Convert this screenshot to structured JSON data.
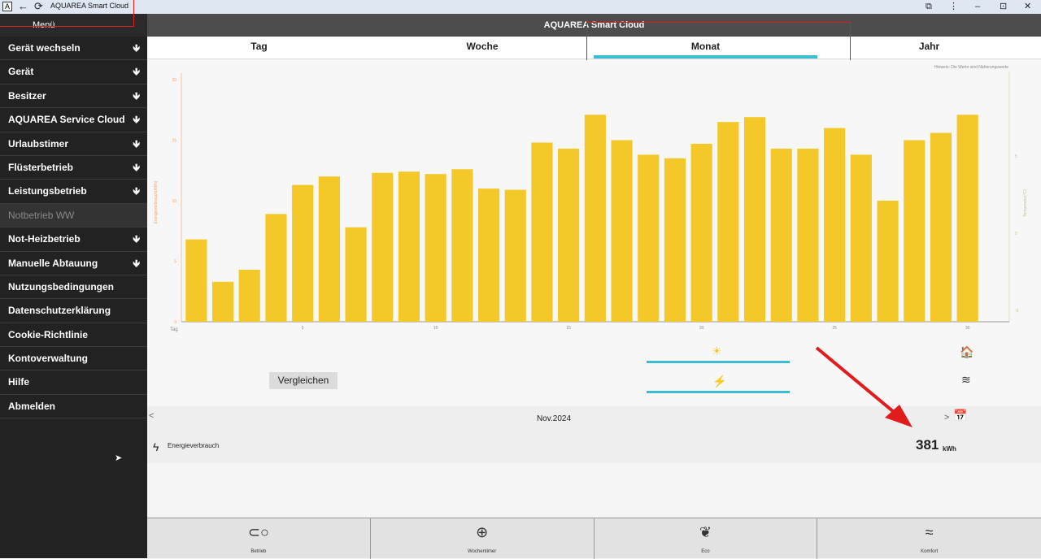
{
  "titlebar": {
    "app_icon": "A",
    "back": "←",
    "reload": "⟳",
    "title": "AQUAREA Smart Cloud",
    "extension_icon": "⧉",
    "more_icon": "⋮",
    "minimize": "–",
    "restore": "⊡",
    "close": "✕"
  },
  "sidebar": {
    "header": "Menü",
    "items": [
      {
        "label": "Gerät wechseln",
        "arrow": "🡻"
      },
      {
        "label": "Gerät",
        "arrow": "🡻"
      },
      {
        "label": "Besitzer",
        "arrow": "🡻"
      },
      {
        "label": "AQUAREA Service Cloud",
        "arrow": "🡻"
      },
      {
        "label": "Urlaubstimer",
        "arrow": "🡻"
      },
      {
        "label": "Flüsterbetrieb",
        "arrow": "🡻"
      },
      {
        "label": "Leistungsbetrieb",
        "arrow": "🡻"
      },
      {
        "label": "Notbetrieb WW",
        "arrow": ""
      },
      {
        "label": "Not-Heizbetrieb",
        "arrow": "🡻"
      },
      {
        "label": "Manuelle Abtauung",
        "arrow": "🡻"
      },
      {
        "label": "Nutzungsbedingungen",
        "arrow": ""
      },
      {
        "label": "Datenschutzerklärung",
        "arrow": ""
      },
      {
        "label": "Cookie-Richtlinie",
        "arrow": ""
      },
      {
        "label": "Kontoverwaltung",
        "arrow": ""
      },
      {
        "label": "Hilfe",
        "arrow": ""
      },
      {
        "label": "Abmelden",
        "arrow": ""
      }
    ]
  },
  "header": {
    "title": "AQUAREA Smart Cloud"
  },
  "tabs": [
    {
      "label": "Tag"
    },
    {
      "label": "Woche"
    },
    {
      "label": "Monat"
    },
    {
      "label": "Jahr"
    }
  ],
  "active_tab": "Monat",
  "hint": "Hinweis: Die Werte sind Näherungswerte",
  "chart_data": {
    "type": "bar",
    "xlabel": "Tag",
    "ylabel": "Energieverbrauch(kWh)",
    "y2label": "Temperatur(°C)",
    "ylim": [
      0,
      20
    ],
    "y2lim": [
      -5,
      5
    ],
    "yticks": [
      0,
      5,
      10,
      15,
      20
    ],
    "y2ticks": [
      -5,
      0,
      5
    ],
    "xticks": [
      5,
      10,
      15,
      20,
      25,
      30
    ],
    "x": [
      1,
      2,
      3,
      4,
      5,
      6,
      7,
      8,
      9,
      10,
      11,
      12,
      13,
      14,
      15,
      16,
      17,
      18,
      19,
      20,
      21,
      22,
      23,
      24,
      25,
      26,
      27,
      28,
      29,
      30
    ],
    "values": [
      6.8,
      3.3,
      4.3,
      8.9,
      11.3,
      12.0,
      7.8,
      12.3,
      12.4,
      12.2,
      12.6,
      11.0,
      10.9,
      14.8,
      14.3,
      17.1,
      15.0,
      13.8,
      13.5,
      14.7,
      16.5,
      16.9,
      14.3,
      14.3,
      16.0,
      13.8,
      10.0,
      15.0,
      15.6,
      17.1
    ],
    "bar_color": "#f4c829",
    "grid": false
  },
  "compare_button": "Vergleichen",
  "legend": {
    "sun_icon": "☀",
    "heat_icon": "⚡",
    "house_icon": "🏠",
    "layers_icon": "≋"
  },
  "period": {
    "prev": "<",
    "label": "Nov.2024",
    "next": ">",
    "calendar_icon": "📅",
    "bolt_icon": "ϟ",
    "metric_label": "Energieverbrauch",
    "value": "381",
    "unit": "kWh"
  },
  "bottom_nav": [
    {
      "label": "Betrieb",
      "icon": "⊂○"
    },
    {
      "label": "Wochentimer",
      "icon": "⊕"
    },
    {
      "label": "Eco",
      "icon": "❦"
    },
    {
      "label": "Komfort",
      "icon": "≈"
    }
  ],
  "colors": {
    "accent": "#3dbcd6",
    "bar": "#f4c829",
    "sidebar": "#222222",
    "annotation": "#e01c1c"
  }
}
